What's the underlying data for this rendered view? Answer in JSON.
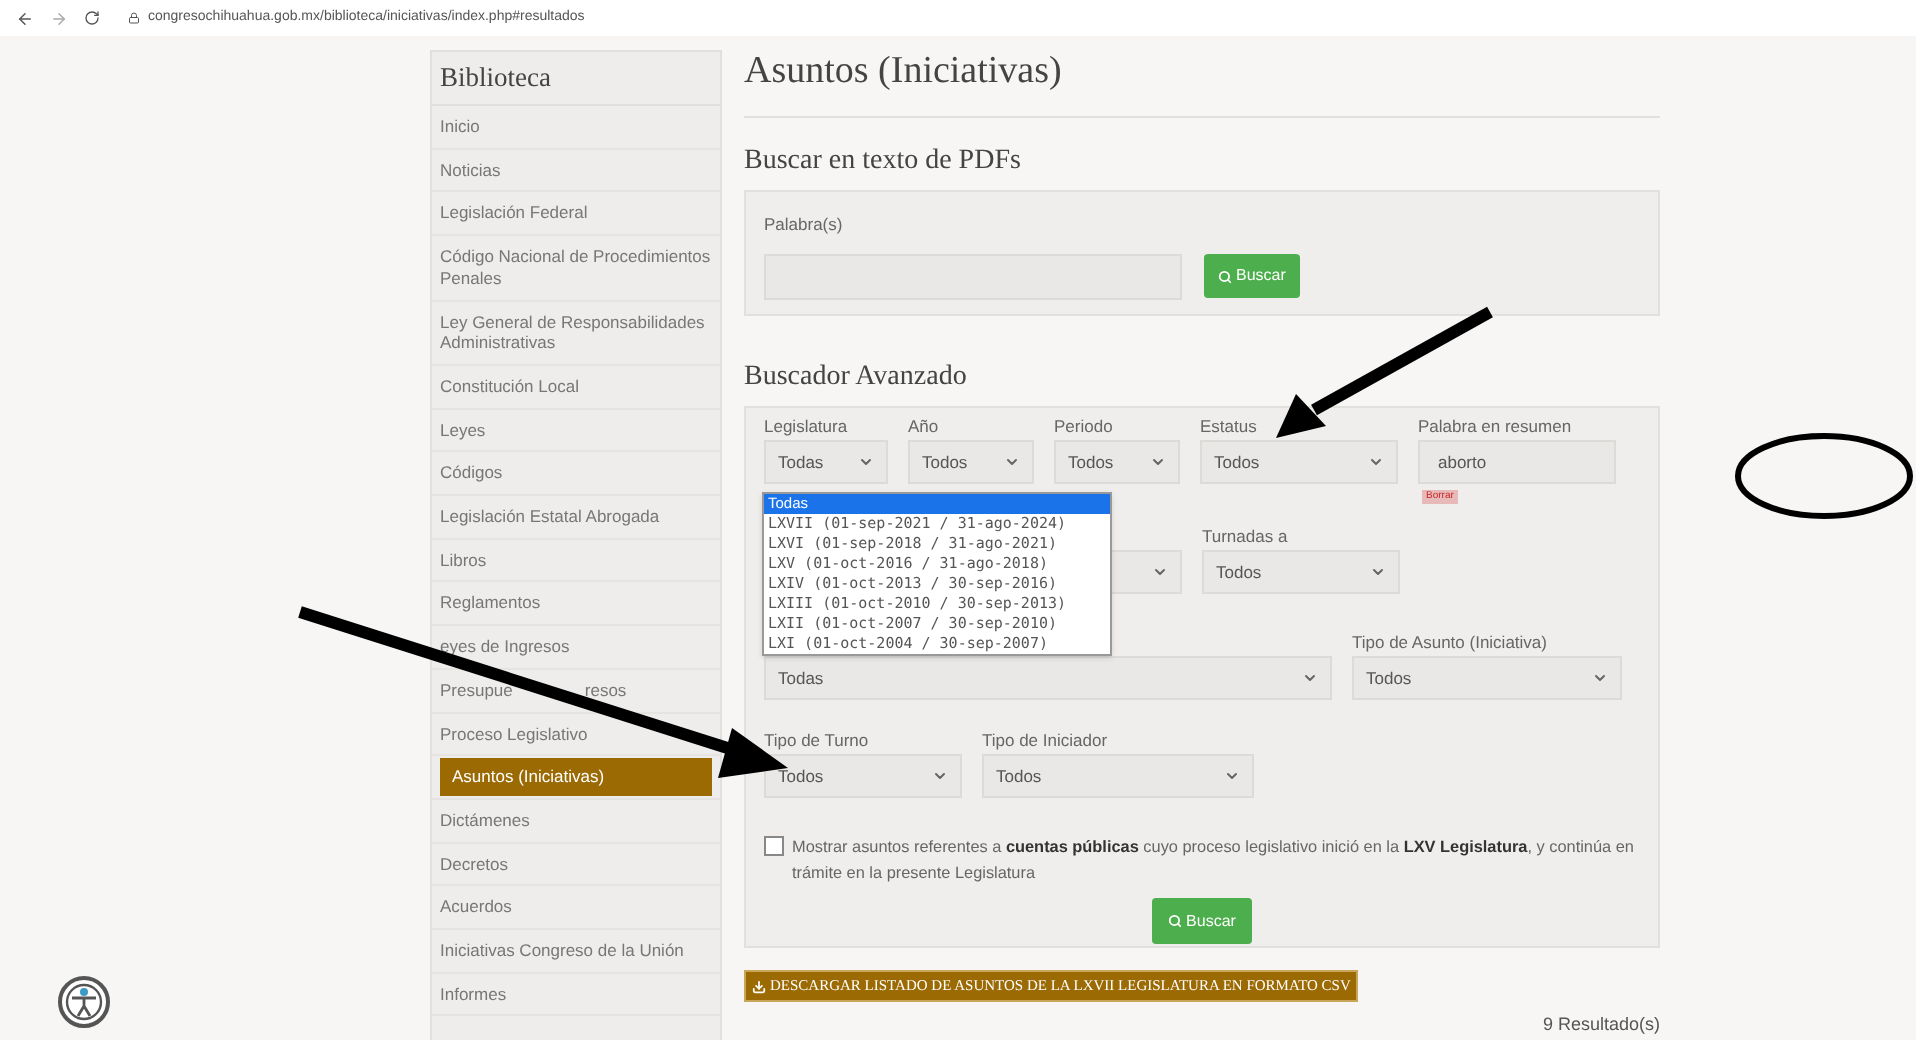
{
  "browser": {
    "url": "congresochihuahua.gob.mx/biblioteca/iniciativas/index.php#resultados"
  },
  "sidebar": {
    "title": "Biblioteca",
    "items": [
      {
        "label": "Inicio",
        "selected": false
      },
      {
        "label": "Noticias",
        "selected": false
      },
      {
        "label": "Legislación Federal",
        "selected": false
      },
      {
        "label": "Código Nacional de Procedimientos Penales",
        "selected": false
      },
      {
        "label": "Ley General de Responsabilidades Administrativas",
        "selected": false
      },
      {
        "label": "Constitución Local",
        "selected": false
      },
      {
        "label": "Leyes",
        "selected": false
      },
      {
        "label": "Códigos",
        "selected": false
      },
      {
        "label": "Legislación Estatal Abrogada",
        "selected": false
      },
      {
        "label": "Libros",
        "selected": false
      },
      {
        "label": "Reglamentos",
        "selected": false
      },
      {
        "label": "eyes de Ingresos",
        "selected": false
      },
      {
        "label": "Presupue",
        "label_end": "resos",
        "selected": false
      },
      {
        "label": "Proceso Legislativo",
        "selected": false
      },
      {
        "label": "Asuntos (Iniciativas)",
        "selected": true
      },
      {
        "label": "Dictámenes",
        "selected": false
      },
      {
        "label": "Decretos",
        "selected": false
      },
      {
        "label": "Acuerdos",
        "selected": false
      },
      {
        "label": "Iniciativas Congreso de la Unión",
        "selected": false
      },
      {
        "label": "Informes",
        "selected": false
      }
    ]
  },
  "page_title": "Asuntos (Iniciativas)",
  "pdf_search": {
    "title": "Buscar en texto de PDFs",
    "field_label": "Palabra(s)",
    "button": "Buscar"
  },
  "advanced_search": {
    "title": "Buscador Avanzado",
    "fields": [
      {
        "kind": "select",
        "label": "Legislatura",
        "value": "Todas"
      },
      {
        "kind": "select",
        "label": "Año",
        "value": "Todos"
      },
      {
        "kind": "select",
        "label": "Periodo",
        "value": "Todos"
      },
      {
        "kind": "select",
        "label": "Estatus",
        "value": "Todos"
      },
      {
        "kind": "text",
        "label": "Palabra en resumen",
        "value": "aborto",
        "clear": "Borrar"
      },
      {
        "kind": "select"
      },
      {
        "kind": "select",
        "label": "Turnadas a",
        "value": "Todos"
      },
      {
        "kind": "select",
        "value": "Todas"
      },
      {
        "kind": "select",
        "label": "Tipo de Asunto (Iniciativa)",
        "value": "Todos"
      },
      {
        "kind": "select",
        "label": "Tipo de Turno",
        "value": "Todos"
      },
      {
        "kind": "select",
        "label": "Tipo de Iniciador",
        "value": "Todos"
      }
    ],
    "dropdown": {
      "options": [
        {
          "label": "Todas",
          "selected": true
        },
        {
          "label": "LXVII (01-sep-2021 / 31-ago-2024)",
          "selected": false
        },
        {
          "label": "LXVI (01-sep-2018 / 31-ago-2021)",
          "selected": false
        },
        {
          "label": "LXV (01-oct-2016 / 31-ago-2018)",
          "selected": false
        },
        {
          "label": "LXIV (01-oct-2013 / 30-sep-2016)",
          "selected": false
        },
        {
          "label": "LXIII (01-oct-2010 / 30-sep-2013)",
          "selected": false
        },
        {
          "label": "LXII (01-oct-2007 / 30-sep-2010)",
          "selected": false
        },
        {
          "label": "LXI (01-oct-2004 / 30-sep-2007)",
          "selected": false
        }
      ]
    },
    "checkbox": {
      "checked": false,
      "text": "Mostrar asuntos referentes a **cuentas públicas** cuyo proceso legislativo inició en la **LXV Legislatura**, y continúa en trámite en la presente Legislatura"
    },
    "button": "Buscar"
  },
  "download_button": "DESCARGAR LISTADO DE ASUNTOS DE LA LXVII LEGISLATURA EN FORMATO CSV",
  "results": "9 Resultado(s)"
}
